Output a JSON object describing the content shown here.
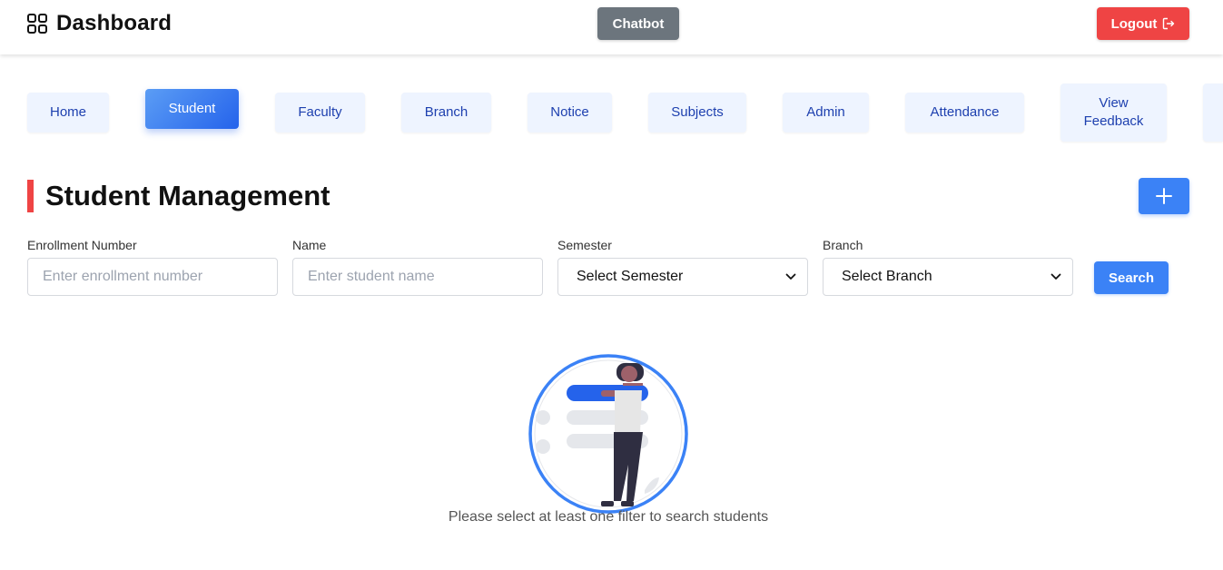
{
  "header": {
    "title": "Dashboard",
    "chatbot_label": "Chatbot",
    "logout_label": "Logout"
  },
  "nav": {
    "tabs": [
      {
        "label": "Home"
      },
      {
        "label": "Student",
        "active": true
      },
      {
        "label": "Faculty"
      },
      {
        "label": "Branch"
      },
      {
        "label": "Notice"
      },
      {
        "label": "Subjects"
      },
      {
        "label": "Admin"
      },
      {
        "label": "Attendance"
      },
      {
        "label": "View Feedback"
      }
    ]
  },
  "page": {
    "title": "Student Management",
    "add_button_icon": "plus-icon"
  },
  "filters": {
    "enrollment": {
      "label": "Enrollment Number",
      "placeholder": "Enter enrollment number",
      "value": ""
    },
    "name": {
      "label": "Name",
      "placeholder": "Enter student name",
      "value": ""
    },
    "semester": {
      "label": "Semester",
      "selected": "Select Semester"
    },
    "branch": {
      "label": "Branch",
      "selected": "Select Branch"
    },
    "search_label": "Search"
  },
  "empty_state": {
    "message": "Please select at least one filter to search students"
  },
  "colors": {
    "primary": "#3b82f6",
    "danger": "#ef4444",
    "secondary": "#6c757d",
    "tab_bg": "#eef4ff",
    "tab_text": "#1e40af"
  }
}
